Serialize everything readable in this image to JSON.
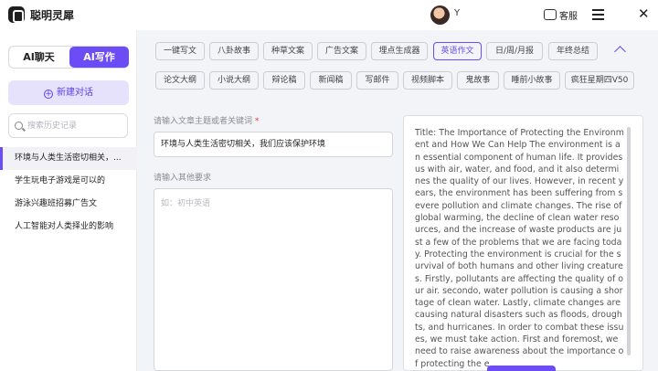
{
  "app": {
    "title": "聪明灵犀"
  },
  "header": {
    "user_name": "Y",
    "customer_service_label": "客服"
  },
  "sidebar": {
    "mode_chat_label": "AI聊天",
    "mode_write_label": "AI写作",
    "new_chat_label": "新建对话",
    "search_placeholder": "搜索历史记录",
    "history": [
      "环境与人类生活密切相关，...",
      "学生玩电子游戏是可以的",
      "游泳兴趣班招募广告文",
      "人工智能对人类择业的影响"
    ],
    "active_history_index": 0
  },
  "categories": {
    "row1": [
      "一键写文",
      "八卦故事",
      "种草文案",
      "广告文案",
      "埋点生成器",
      "英语作文",
      "日/周/月报",
      "年终总结"
    ],
    "row2": [
      "论文大纲",
      "小说大纲",
      "辩论稿",
      "新闻稿",
      "写邮件",
      "视频脚本",
      "鬼故事",
      "睡前小故事",
      "疯狂星期四V50"
    ],
    "selected": "英语作文"
  },
  "form": {
    "topic_label": "请输入文章主题或者关键词",
    "topic_required_mark": "*",
    "topic_value": "环境与人类生活密切相关，我们应该保护环境",
    "extra_label": "请输入其他要求",
    "extra_placeholder": "如：初中英语"
  },
  "output": {
    "text": "Title: The Importance of Protecting the Environment and How We Can Help The environment is an essential component of human life. It provides us with air, water, and food, and it also determines the quality of our lives. However, in recent years, the environment has been suffering from severe pollution and climate changes. The rise of global warming, the decline of clean water resources, and the increase of waste products are just a few of the problems that we are facing today. Protecting the environment is crucial for the survival of both humans and other living creatures. Firstly, pollutants are affecting the quality of our air. secondo, water pollution is causing a shortage of clean water. Lastly, climate changes are causing natural disasters such as floods, droughts, and hurricanes. In order to combat these issues, we must take action. First and foremost, we need to raise awareness about the importance of protecting the e"
  },
  "colors": {
    "accent": "#6b4cf5",
    "accent_light": "#e6e2fb",
    "background": "#f3f4f8"
  },
  "icons": {
    "logo": "app-logo-icon",
    "customer_service": "chat-bubble-icon",
    "menu": "menu-icon",
    "close": "close-icon",
    "new_chat": "plus-circle-icon",
    "search": "search-icon",
    "collapse": "chevron-up-icon"
  }
}
